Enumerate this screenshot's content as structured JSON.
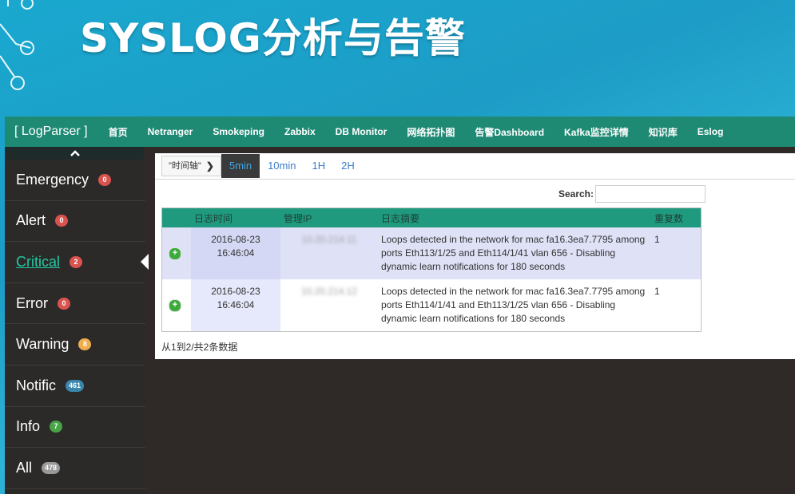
{
  "slide": {
    "title": "SYSLOG分析与告警"
  },
  "navbar": {
    "brand": "[ LogParser ]",
    "items": [
      "首页",
      "Netranger",
      "Smokeping",
      "Zabbix",
      "DB Monitor",
      "网络拓扑图",
      "告警Dashboard",
      "Kafka监控详情",
      "知识库",
      "Eslog"
    ]
  },
  "sidebar": {
    "items": [
      {
        "label": "Emergency",
        "count": "0",
        "badge_color": "#d9534f"
      },
      {
        "label": "Alert",
        "count": "0",
        "badge_color": "#d9534f"
      },
      {
        "label": "Critical",
        "count": "2",
        "badge_color": "#d9534f"
      },
      {
        "label": "Error",
        "count": "0",
        "badge_color": "#d9534f"
      },
      {
        "label": "Warning",
        "count": "8",
        "badge_color": "#f0ad4e"
      },
      {
        "label": "Notific",
        "count": "461",
        "badge_color": "#3a87ad"
      },
      {
        "label": "Info",
        "count": "7",
        "badge_color": "#47a447"
      },
      {
        "label": "All",
        "count": "478",
        "badge_color": "#999999"
      }
    ],
    "active": "Critical"
  },
  "timeline": {
    "label": "\"时间轴\"",
    "options": [
      "5min",
      "10min",
      "1H",
      "2H"
    ],
    "selected": "5min"
  },
  "search": {
    "label": "Search:"
  },
  "table": {
    "headers": [
      "日志时间",
      "管理IP",
      "日志摘要",
      "重复数"
    ],
    "rows": [
      {
        "date": "2016-08-23",
        "time": "16:46:04",
        "ip": "10.20.214.11",
        "summary": "Loops detected in the network for mac fa16.3ea7.7795 among ports Eth113/1/25 and Eth114/1/41 vlan 656 - Disabling dynamic learn notifications for 180 seconds",
        "count": "1"
      },
      {
        "date": "2016-08-23",
        "time": "16:46:04",
        "ip": "10.20.214.12",
        "summary": "Loops detected in the network for mac fa16.3ea7.7795 among ports Eth114/1/41 and Eth113/1/25 vlan 656 - Disabling dynamic learn notifications for 180 seconds",
        "count": "1"
      }
    ]
  },
  "footer": {
    "info": "从1到2/共2条数据"
  },
  "colors": {
    "navbar": "#1f8a74",
    "table_header": "#1f9a7e",
    "active_text": "#22c9a2"
  }
}
